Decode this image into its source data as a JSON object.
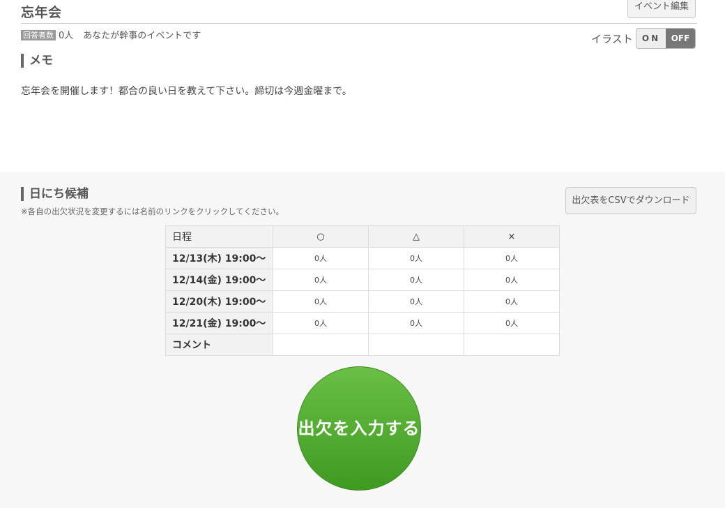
{
  "event": {
    "title": "忘年会",
    "edit_label": "イベント編集",
    "respondents_badge": "回答者数",
    "respondents_count": "0人",
    "organizer_note": "あなたが幹事のイベントです"
  },
  "illustration": {
    "label": "イラスト",
    "on": "ON",
    "off": "OFF",
    "state": "OFF"
  },
  "memo": {
    "heading": "メモ",
    "text": "忘年会を開催します！都合の良い日を教えて下さい。締切は今週金曜まで。"
  },
  "schedule": {
    "heading": "日にち候補",
    "note": "※各自の出欠状況を変更するには名前のリンクをクリックしてください。",
    "csv_label": "出欠表をCSVでダウンロード",
    "header": {
      "date": "日程",
      "yes": "○",
      "maybe": "△",
      "no": "×"
    },
    "rows": [
      {
        "date": "12/13(木) 19:00〜",
        "yes": "0人",
        "maybe": "0人",
        "no": "0人"
      },
      {
        "date": "12/14(金) 19:00〜",
        "yes": "0人",
        "maybe": "0人",
        "no": "0人"
      },
      {
        "date": "12/20(木) 19:00〜",
        "yes": "0人",
        "maybe": "0人",
        "no": "0人"
      },
      {
        "date": "12/21(金) 19:00〜",
        "yes": "0人",
        "maybe": "0人",
        "no": "0人"
      }
    ],
    "comment_label": "コメント"
  },
  "submit_label": "出欠を入力する",
  "colors": {
    "submit_green": "#4fa82e",
    "toggle_off": "#777777"
  }
}
